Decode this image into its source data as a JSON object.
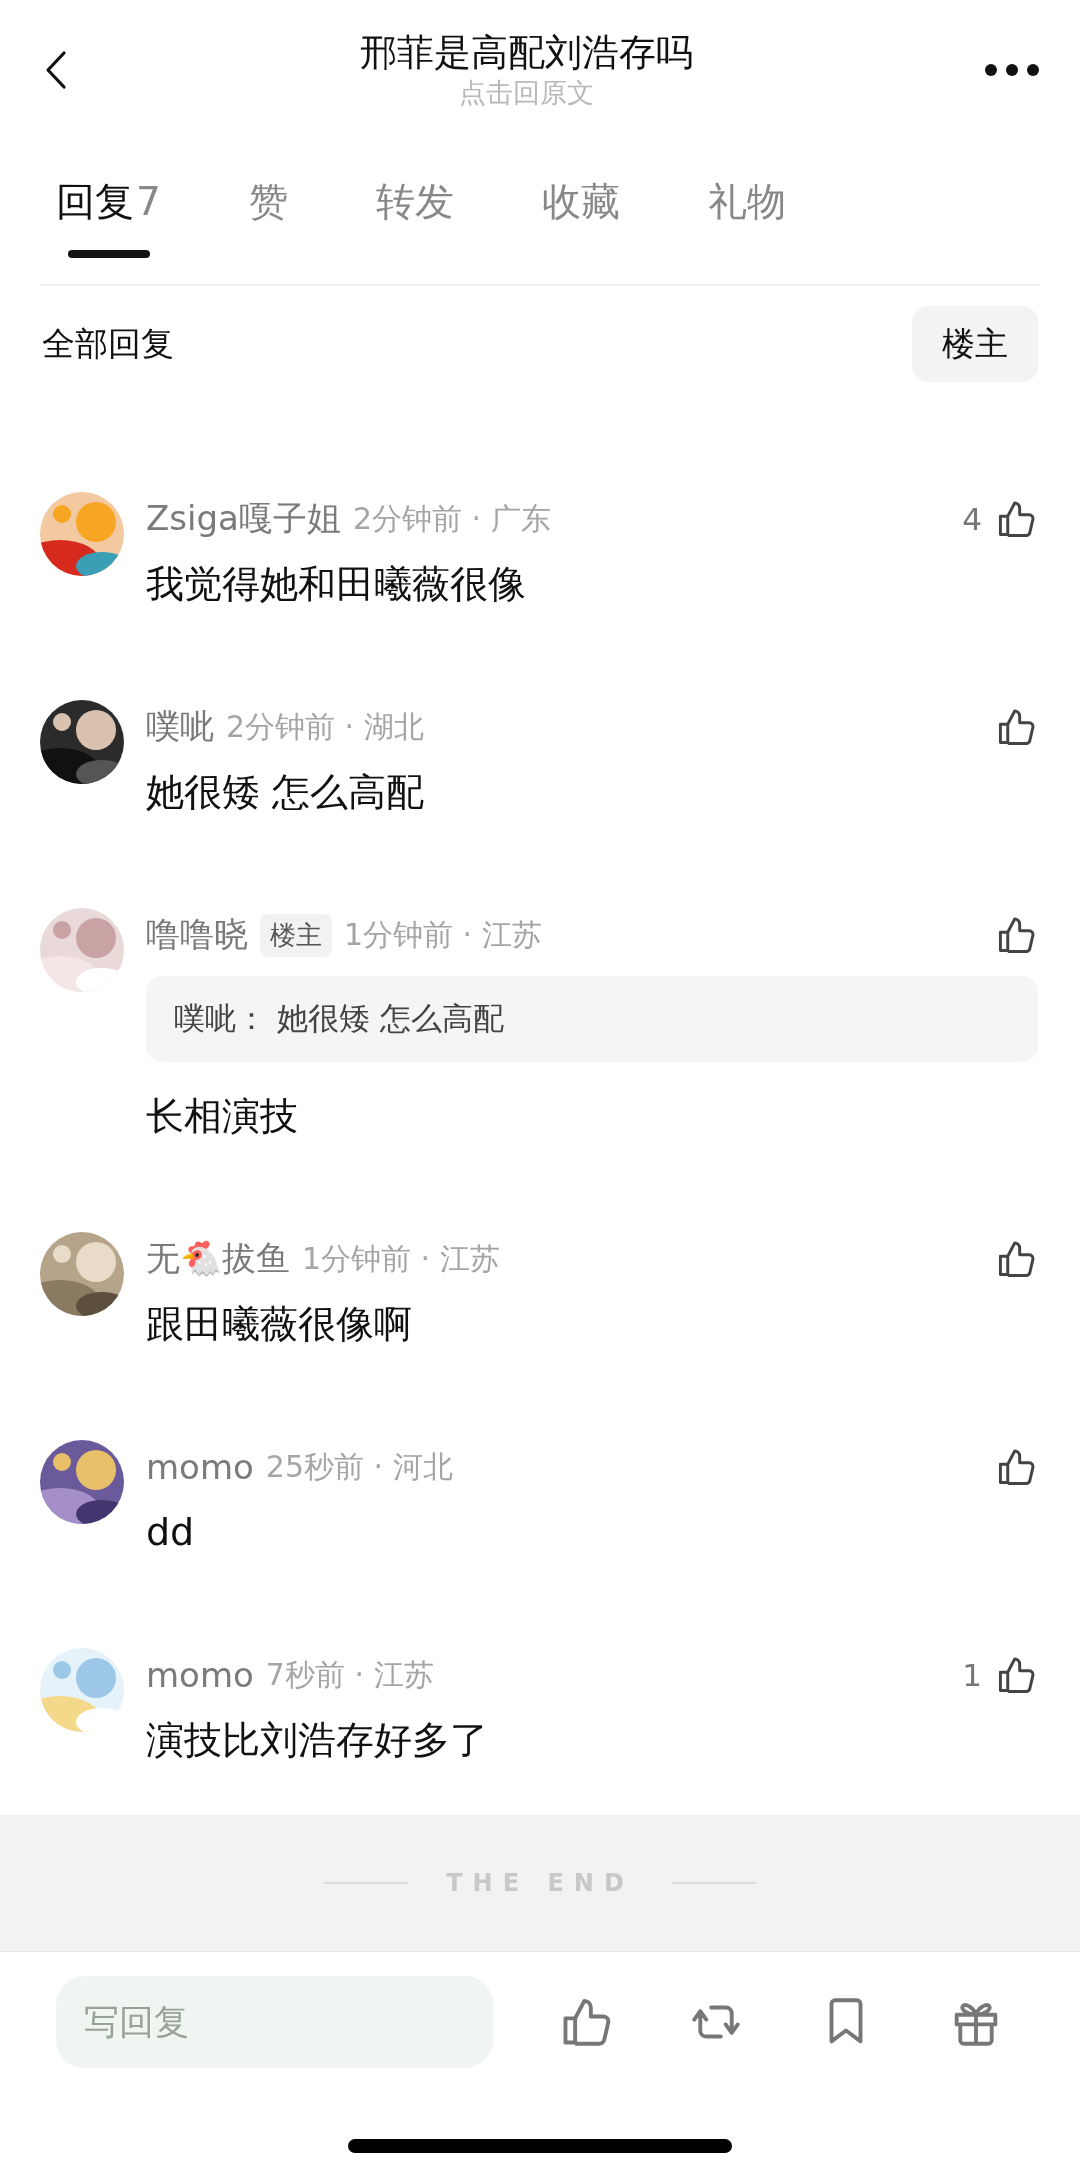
{
  "header": {
    "title": "邢菲是高配刘浩存吗",
    "subtitle": "点击回原文"
  },
  "tabs": [
    {
      "label": "回复",
      "count": "7",
      "selected": true
    },
    {
      "label": "赞",
      "selected": false
    },
    {
      "label": "转发",
      "selected": false
    },
    {
      "label": "收藏",
      "selected": false
    },
    {
      "label": "礼物",
      "selected": false
    }
  ],
  "filter": {
    "label": "全部回复",
    "button": "楼主"
  },
  "comments": [
    {
      "name": "Zsiga嘎子姐",
      "time": "2分钟前 · 广东",
      "likes": "4",
      "text": "我觉得她和田曦薇很像"
    },
    {
      "name": "噗呲",
      "time": "2分钟前 · 湖北",
      "text": "她很矮 怎么高配"
    },
    {
      "name": "噜噜晓",
      "badge": "楼主",
      "time": "1分钟前 · 江苏",
      "quote": "噗呲： 她很矮 怎么高配",
      "text": "长相演技"
    },
    {
      "name": "无🐔拔鱼",
      "time": "1分钟前 · 江苏",
      "text": "跟田曦薇很像啊"
    },
    {
      "name": "momo",
      "time": "25秒前 · 河北",
      "text": "dd"
    },
    {
      "name": "momo",
      "time": "7秒前 · 江苏",
      "likes": "1",
      "text": "演技比刘浩存好多了"
    }
  ],
  "end_marker": "THE END",
  "reply_field": {
    "placeholder": "写回复"
  }
}
